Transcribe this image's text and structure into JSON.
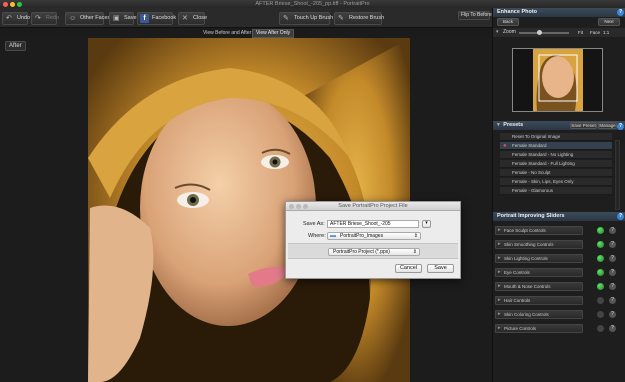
{
  "window": {
    "title": "AFTER Briese_Shoot_-205_pp.tiff - PortraitPro"
  },
  "toolbar": {
    "undo": "Undo",
    "redo": "Redo",
    "other_faces": "Other Faces",
    "save": "Save",
    "facebook": "Facebook",
    "close": "Close",
    "touch_up_brush": "Touch Up Brush",
    "restore_brush": "Restore Brush",
    "flip_to_before": "Flip To Before"
  },
  "view_tabs": [
    "View Before and After",
    "View After Only"
  ],
  "canvas": {
    "label": "After"
  },
  "enhance_panel": {
    "title": "Enhance Photo",
    "back": "Back",
    "next": "Next",
    "zoom_label": "Zoom",
    "fit": "Fit",
    "face": "Face",
    "ratio": "1:1"
  },
  "presets_panel": {
    "title": "Presets",
    "save_preset": "Save Preset",
    "manage": "Manage",
    "items": [
      "Reset To Original Image",
      "Female Standard",
      "Female Standard - No Lighting",
      "Female Standard - Full Lighting",
      "Female - No Sculpt",
      "Female - Skin, Lips, Eyes Only",
      "Female - Glamorous"
    ]
  },
  "sliders_panel": {
    "title": "Portrait Improving Sliders",
    "items": [
      "Face Sculpt Controls",
      "Skin Smoothing Controls",
      "Skin Lighting Controls",
      "Eye Controls",
      "Mouth & Nose Controls",
      "Hair Controls",
      "Skin Coloring Controls",
      "Picture Controls"
    ]
  },
  "dialog": {
    "title": "Save PortraitPro Project File",
    "save_as_label": "Save As:",
    "save_as_value": "AFTER Briese_Shoot_-205",
    "where_label": "Where:",
    "where_value": "PortraitPro_Images",
    "format": "PortraitPro Project (*.ppx)",
    "cancel": "Cancel",
    "save": "Save"
  }
}
